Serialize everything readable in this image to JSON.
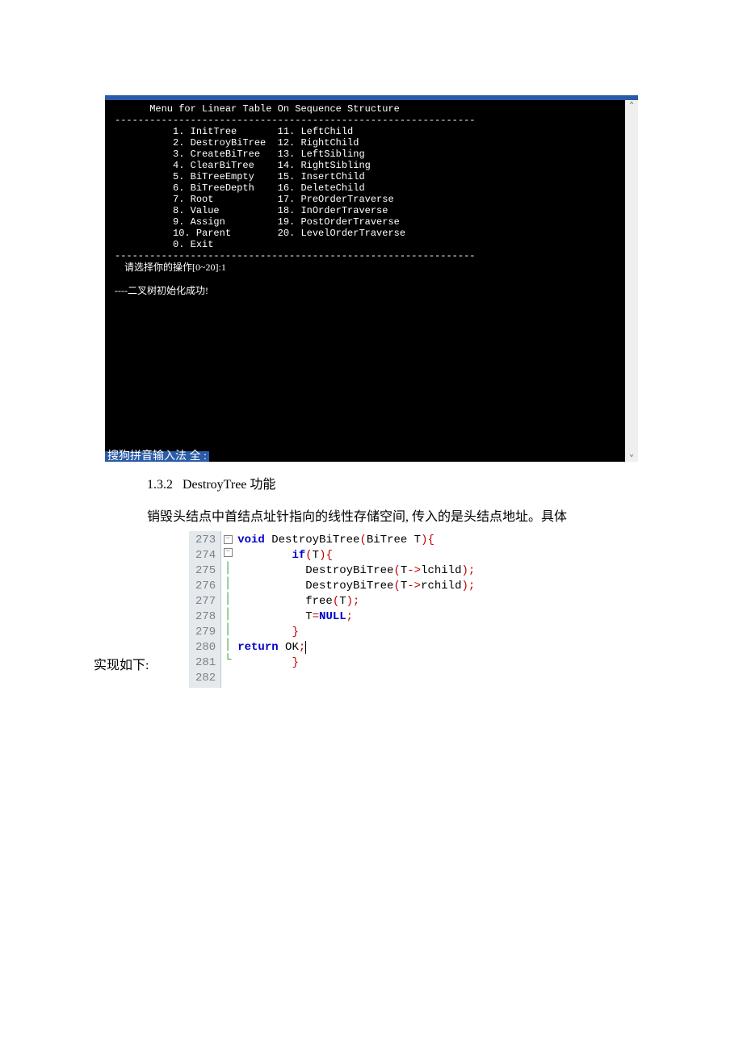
{
  "console": {
    "header": "      Menu for Linear Table On Sequence Structure",
    "divider": "--------------------------------------------------------------",
    "menu_left": [
      "1. InitTree",
      "2. DestroyBiTree",
      "3. CreateBiTree",
      "4. ClearBiTree",
      "5. BiTreeEmpty",
      "6. BiTreeDepth",
      "7. Root",
      "8. Value",
      "9. Assign",
      "10. Parent",
      "0. Exit"
    ],
    "menu_right": [
      "11. LeftChild",
      "12. RightChild",
      "13. LeftSibling",
      "14. RightSibling",
      "15. InsertChild",
      "16. DeleteChild",
      "17. PreOrderTraverse",
      "18. InOrderTraverse",
      "19. PostOrderTraverse",
      "20. LevelOrderTraverse",
      ""
    ],
    "prompt": "    请选择你的操作[0~20]:1",
    "result": "----二叉树初始化成功!",
    "ime": "搜狗拼音输入法 全 :"
  },
  "doc": {
    "section_no": "1.3.2",
    "section_title": "DestroyTree 功能",
    "para": "销毁头结点中首结点址针指向的线性存储空间, 传入的是头结点地址。具体",
    "impl_label": "实现如下:"
  },
  "code": {
    "line_nos": [
      "273",
      "274",
      "275",
      "276",
      "277",
      "278",
      "279",
      "280",
      "281",
      "282"
    ],
    "tokens": [
      [
        {
          "t": "void",
          "c": "kw"
        },
        {
          "t": " DestroyBiTree",
          "c": "normal"
        },
        {
          "t": "(",
          "c": "punct"
        },
        {
          "t": "BiTree T",
          "c": "normal"
        },
        {
          "t": "){",
          "c": "punct"
        }
      ],
      [
        {
          "t": "        ",
          "c": "normal"
        },
        {
          "t": "if",
          "c": "kw"
        },
        {
          "t": "(",
          "c": "punct"
        },
        {
          "t": "T",
          "c": "normal"
        },
        {
          "t": "){",
          "c": "punct"
        }
      ],
      [
        {
          "t": "          DestroyBiTree",
          "c": "normal"
        },
        {
          "t": "(",
          "c": "punct"
        },
        {
          "t": "T",
          "c": "normal"
        },
        {
          "t": "->",
          "c": "punct"
        },
        {
          "t": "lchild",
          "c": "normal"
        },
        {
          "t": ");",
          "c": "punct"
        }
      ],
      [
        {
          "t": "          DestroyBiTree",
          "c": "normal"
        },
        {
          "t": "(",
          "c": "punct"
        },
        {
          "t": "T",
          "c": "normal"
        },
        {
          "t": "->",
          "c": "punct"
        },
        {
          "t": "rchild",
          "c": "normal"
        },
        {
          "t": ");",
          "c": "punct"
        }
      ],
      [
        {
          "t": "          free",
          "c": "normal"
        },
        {
          "t": "(",
          "c": "punct"
        },
        {
          "t": "T",
          "c": "normal"
        },
        {
          "t": ");",
          "c": "punct"
        }
      ],
      [
        {
          "t": "          T",
          "c": "normal"
        },
        {
          "t": "=",
          "c": "punct"
        },
        {
          "t": "NULL",
          "c": "kw"
        },
        {
          "t": ";",
          "c": "punct"
        }
      ],
      [
        {
          "t": "        ",
          "c": "normal"
        },
        {
          "t": "}",
          "c": "punct"
        }
      ],
      [
        {
          "t": "return",
          "c": "kw"
        },
        {
          "t": " OK",
          "c": "normal"
        },
        {
          "t": ";",
          "c": "punct cursor"
        }
      ],
      [
        {
          "t": "        ",
          "c": "normal"
        },
        {
          "t": "}",
          "c": "punct"
        }
      ],
      [
        {
          "t": "",
          "c": "normal"
        }
      ]
    ]
  }
}
